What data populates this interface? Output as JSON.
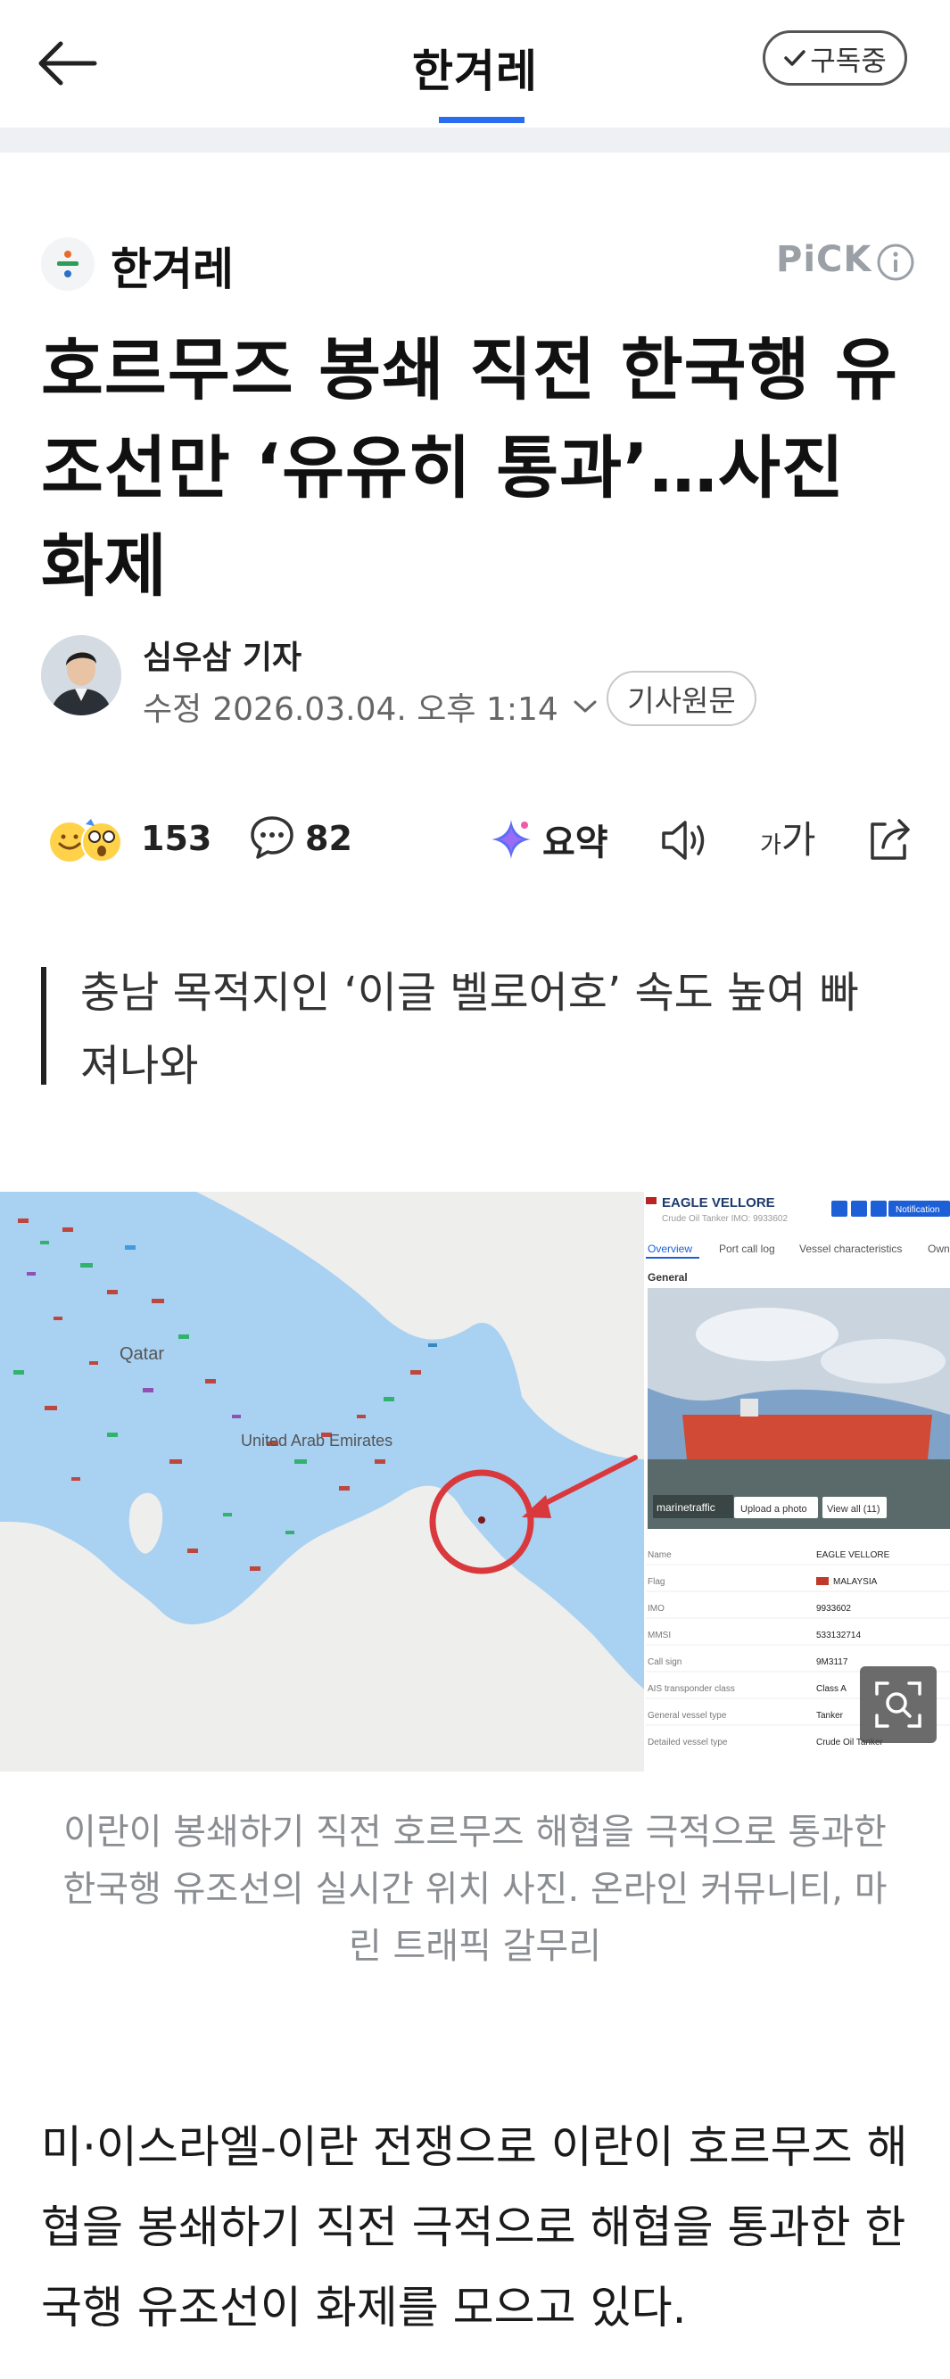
{
  "topbar": {
    "title": "한겨레",
    "subscribe_label": "구독중"
  },
  "press": {
    "name": "한겨레",
    "pick_label": "PiCK"
  },
  "article": {
    "headline": "호르무즈 봉쇄 직전 한국행 유조선만 ‘유유히 통과’…사진 화제",
    "reporter": "심우삼 기자",
    "updated_label": "수정",
    "updated_at": "2026.03.04. 오후 1:14",
    "original_label": "기사원문",
    "subtitle": "충남 목적지인 ‘이글 벨로어호’ 속도 높여 빠져나와",
    "caption": "이란이 봉쇄하기 직전 호르무즈 해협을 극적으로 통과한 한국행 유조선의 실시간 위치 사진. 온라인 커뮤니티, 마린 트래픽 갈무리",
    "body": "미·이스라엘-이란 전쟁으로 이란이 호르무즈 해협을 봉쇄하기 직전 극적으로 해협을 통과한 한국행 유조선이 화제를 모으고 있다."
  },
  "actions": {
    "reaction_count": "153",
    "comment_count": "82",
    "summary_label": "요약",
    "font_small": "가",
    "font_big": "가"
  },
  "photo": {
    "map_labels": {
      "qatar": "Qatar",
      "uae": "United Arab Emirates"
    },
    "panel": {
      "vessel_name": "EAGLE VELLORE",
      "vessel_sub": "Crude Oil Tanker  IMO: 9933602",
      "notification_label": "Notification",
      "tabs": [
        "Overview",
        "Port call log",
        "Vessel characteristics",
        "Owne"
      ],
      "section_label": "General",
      "upload_label": "Upload a photo",
      "view_all_label": "View all (11)",
      "watermark": "marinetraffic",
      "rows": [
        {
          "key": "Name",
          "value": "EAGLE VELLORE"
        },
        {
          "key": "Flag",
          "value": "MALAYSIA"
        },
        {
          "key": "IMO",
          "value": "9933602"
        },
        {
          "key": "MMSI",
          "value": "533132714"
        },
        {
          "key": "Call sign",
          "value": "9M3117"
        },
        {
          "key": "AIS transponder class",
          "value": "Class A"
        },
        {
          "key": "General vessel type",
          "value": "Tanker"
        },
        {
          "key": "Detailed vessel type",
          "value": "Crude Oil Tanker"
        }
      ]
    }
  },
  "colors": {
    "accent": "#2a6cf0",
    "sea": "#a9d1f2",
    "highlight": "#d9393c"
  },
  "icons": [
    "back-arrow-icon",
    "check-icon",
    "info-icon",
    "comment-icon",
    "summary-sparkle-icon",
    "speaker-icon",
    "share-icon",
    "zoom-search-icon"
  ]
}
